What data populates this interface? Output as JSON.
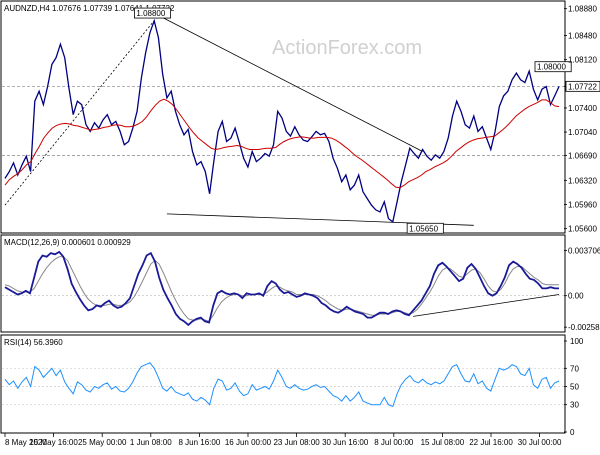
{
  "chart_data": [
    {
      "type": "line",
      "panel": "price",
      "title": "AUDNZD,H4  1.07676 1.07739 1.07641 1.07722",
      "watermark": "ActionForex.com",
      "ylim": [
        1.0555,
        1.0895
      ],
      "y_ticks": [
        "1.08880",
        "1.08480",
        "1.08120",
        "1.07722",
        "1.07400",
        "1.07040",
        "1.06690",
        "1.06320",
        "1.05960",
        "1.05600"
      ],
      "last_price": 1.07722,
      "last_price_label": "1.07722",
      "level_lines": [
        {
          "value": 1.0669,
          "label": "1.06690"
        },
        {
          "value": 1.07722,
          "label": "1.07722"
        }
      ],
      "annotations": [
        {
          "label": "1.08800",
          "x": 36,
          "y": 1.088
        },
        {
          "label": "1.05650",
          "x": 100,
          "y": 1.0565
        },
        {
          "label": "1.08000",
          "x": 130,
          "y": 1.08
        }
      ],
      "trendlines": [
        {
          "x": [
            36,
            98
          ],
          "y": [
            1.0878,
            1.0675
          ]
        },
        {
          "x": [
            38,
            110
          ],
          "y": [
            1.0582,
            1.0565
          ]
        },
        {
          "x": [
            0,
            36
          ],
          "y": [
            1.0595,
            1.0878
          ]
        }
      ],
      "series": [
        {
          "name": "price",
          "color": "#000080",
          "values": [
            1.0635,
            1.0645,
            1.0658,
            1.064,
            1.0655,
            1.0668,
            1.0645,
            1.075,
            1.0765,
            1.0745,
            1.0772,
            1.0805,
            1.0815,
            1.0835,
            1.0815,
            1.077,
            1.073,
            1.075,
            1.0745,
            1.0715,
            1.0705,
            1.0718,
            1.071,
            1.0722,
            1.073,
            1.0715,
            1.072,
            1.0705,
            1.0685,
            1.069,
            1.071,
            1.0735,
            1.0785,
            1.0822,
            1.0852,
            1.087,
            1.0845,
            1.079,
            1.0755,
            1.0765,
            1.0735,
            1.0715,
            1.07,
            1.0708,
            1.0675,
            1.0655,
            1.066,
            1.0645,
            1.0612,
            1.066,
            1.0705,
            1.072,
            1.069,
            1.0695,
            1.071,
            1.0688,
            1.0665,
            1.0652,
            1.0675,
            1.066,
            1.0665,
            1.0672,
            1.0668,
            1.0685,
            1.0735,
            1.0725,
            1.0705,
            1.0698,
            1.0712,
            1.07,
            1.0692,
            1.069,
            1.0697,
            1.0705,
            1.07,
            1.0702,
            1.069,
            1.0665,
            1.065,
            1.063,
            1.064,
            1.0618,
            1.0625,
            1.064,
            1.0615,
            1.0605,
            1.0595,
            1.0588,
            1.0585,
            1.06,
            1.0575,
            1.057,
            1.06,
            1.063,
            1.0655,
            1.068,
            1.0672,
            1.0665,
            1.0678,
            1.0668,
            1.0662,
            1.067,
            1.0665,
            1.0675,
            1.0695,
            1.0728,
            1.075,
            1.0735,
            1.0715,
            1.071,
            1.0728,
            1.0705,
            1.0712,
            1.0695,
            1.0678,
            1.0705,
            1.0742,
            1.0758,
            1.0765,
            1.0782,
            1.0792,
            1.0782,
            1.0778,
            1.0795,
            1.0768,
            1.0752,
            1.0768,
            1.0772,
            1.0745,
            1.0758,
            1.0772
          ]
        },
        {
          "name": "MA",
          "color": "#cc0000",
          "values": [
            1.0625,
            1.0633,
            1.0638,
            1.0642,
            1.0648,
            1.0655,
            1.066,
            1.0672,
            1.0683,
            1.0695,
            1.0703,
            1.071,
            1.0714,
            1.0716,
            1.0717,
            1.0716,
            1.0714,
            1.0713,
            1.0711,
            1.0709,
            1.0707,
            1.0708,
            1.0709,
            1.0711,
            1.0712,
            1.0714,
            1.0715,
            1.0714,
            1.0712,
            1.0712,
            1.0713,
            1.0716,
            1.072,
            1.0727,
            1.0736,
            1.0744,
            1.075,
            1.0753,
            1.075,
            1.0745,
            1.0737,
            1.0728,
            1.0719,
            1.071,
            1.0702,
            1.0695,
            1.069,
            1.0685,
            1.068,
            1.0678,
            1.0679,
            1.0681,
            1.0682,
            1.0683,
            1.0684,
            1.0683,
            1.068,
            1.0678,
            1.0678,
            1.0678,
            1.0679,
            1.068,
            1.068,
            1.0681,
            1.0686,
            1.069,
            1.0693,
            1.0695,
            1.0696,
            1.0697,
            1.0696,
            1.0695,
            1.0695,
            1.0696,
            1.0696,
            1.0696,
            1.0695,
            1.0692,
            1.0688,
            1.0683,
            1.0678,
            1.0672,
            1.0667,
            1.0663,
            1.0658,
            1.0653,
            1.0648,
            1.0643,
            1.0638,
            1.0633,
            1.0627,
            1.0622,
            1.0621,
            1.0625,
            1.063,
            1.0633,
            1.0636,
            1.064,
            1.0645,
            1.0648,
            1.0652,
            1.0655,
            1.0658,
            1.0662,
            1.0668,
            1.0675,
            1.068,
            1.0685,
            1.0689,
            1.0692,
            1.0694,
            1.0695,
            1.0696,
            1.0697,
            1.0698,
            1.0703,
            1.0708,
            1.0714,
            1.0721,
            1.0728,
            1.0733,
            1.0738,
            1.0742,
            1.0745,
            1.0748,
            1.0752,
            1.0752,
            1.0748,
            1.0743,
            1.0742
          ]
        }
      ]
    },
    {
      "type": "line",
      "panel": "macd",
      "title": "MACD(12,26,9) 0.000601 0.000929",
      "ylim": [
        -0.0029,
        0.004
      ],
      "y_ticks": [
        "0.003706",
        "0.00",
        "-0.002585"
      ],
      "trendlines": [
        {
          "x": [
            98,
            133
          ],
          "y": [
            -0.0017,
            0.0001
          ]
        }
      ],
      "series": [
        {
          "name": "MACD",
          "color": "#1a1a99",
          "values": [
            0.0007,
            0.0005,
            0.0003,
            0.0001,
            0.0002,
            0.0004,
            0.0002,
            0.0015,
            0.0028,
            0.0033,
            0.0032,
            0.0035,
            0.0034,
            0.0036,
            0.0032,
            0.0022,
            0.001,
            0.0003,
            -0.0003,
            -0.0008,
            -0.0012,
            -0.0011,
            -0.0008,
            -0.0009,
            -0.0006,
            -0.0004,
            -0.0008,
            -0.001,
            -0.0009,
            -0.0006,
            -0.0002,
            0.0008,
            0.0018,
            0.0025,
            0.0033,
            0.0035,
            0.0028,
            0.0015,
            0.0005,
            -0.0002,
            -0.0008,
            -0.0015,
            -0.0019,
            -0.0021,
            -0.0024,
            -0.0021,
            -0.0019,
            -0.0018,
            -0.0021,
            -0.0022,
            -0.0008,
            0.0002,
            0.0004,
            0.0002,
            0.0001,
            0.0002,
            0.0001,
            -0.0002,
            0.0002,
            0.0001,
            0.0001,
            0.0002,
            0.0,
            0.0008,
            0.0012,
            0.001,
            0.0005,
            0.0002,
            0.0003,
            0.0001,
            -0.0001,
            0.0,
            0.0002,
            0.0001,
            0.0,
            -0.0002,
            -0.0006,
            -0.0008,
            -0.0011,
            -0.0013,
            -0.0014,
            -0.0012,
            -0.0009,
            -0.0011,
            -0.0013,
            -0.0014,
            -0.0015,
            -0.0018,
            -0.0018,
            -0.0016,
            -0.0014,
            -0.0014,
            -0.0015,
            -0.0013,
            -0.0012,
            -0.0013,
            -0.0015,
            -0.0016,
            -0.0012,
            -0.0008,
            -0.0004,
            0.0002,
            0.0008,
            0.0018,
            0.0025,
            0.0027,
            0.0024,
            0.002,
            0.0016,
            0.0012,
            0.0014,
            0.0023,
            0.0026,
            0.0022,
            0.0015,
            0.0008,
            0.0002,
            0.0,
            0.0002,
            0.0008,
            0.0015,
            0.0025,
            0.0028,
            0.0026,
            0.0023,
            0.0018,
            0.0014,
            0.0013,
            0.001,
            0.0006,
            0.0006,
            0.0007,
            0.0006,
            0.0006
          ]
        },
        {
          "name": "Signal",
          "color": "#888888",
          "values": [
            0.0009,
            0.0008,
            0.0006,
            0.0004,
            0.0003,
            0.0003,
            0.0003,
            0.0006,
            0.0012,
            0.0018,
            0.0023,
            0.0027,
            0.003,
            0.0032,
            0.0032,
            0.0029,
            0.0022,
            0.0015,
            0.0008,
            0.0002,
            -0.0003,
            -0.0006,
            -0.0008,
            -0.0008,
            -0.0008,
            -0.0007,
            -0.0007,
            -0.0008,
            -0.0008,
            -0.0007,
            -0.0005,
            -0.0001,
            0.0005,
            0.0012,
            0.0019,
            0.0026,
            0.0029,
            0.0026,
            0.0019,
            0.0011,
            0.0003,
            -0.0004,
            -0.001,
            -0.0015,
            -0.0019,
            -0.002,
            -0.002,
            -0.0019,
            -0.002,
            -0.0021,
            -0.0016,
            -0.001,
            -0.0005,
            -0.0002,
            0.0,
            0.0001,
            0.0001,
            0.0,
            0.0,
            0.0001,
            0.0001,
            0.0001,
            0.0001,
            0.0003,
            0.0006,
            0.0008,
            0.0007,
            0.0005,
            0.0004,
            0.0003,
            0.0001,
            0.0001,
            0.0001,
            0.0001,
            0.0001,
            0.0,
            -0.0002,
            -0.0004,
            -0.0007,
            -0.0009,
            -0.0011,
            -0.0012,
            -0.0011,
            -0.0011,
            -0.0012,
            -0.0013,
            -0.0014,
            -0.0015,
            -0.0016,
            -0.0016,
            -0.0015,
            -0.0015,
            -0.0015,
            -0.0014,
            -0.0013,
            -0.0013,
            -0.0014,
            -0.0015,
            -0.0014,
            -0.0011,
            -0.0007,
            -0.0002,
            0.0003,
            0.0009,
            0.0016,
            0.0021,
            0.0023,
            0.0022,
            0.0019,
            0.0016,
            0.0015,
            0.0018,
            0.0021,
            0.0022,
            0.0019,
            0.0014,
            0.0008,
            0.0004,
            0.0003,
            0.0005,
            0.001,
            0.0017,
            0.0022,
            0.0024,
            0.0024,
            0.0021,
            0.0018,
            0.0015,
            0.0013,
            0.001,
            0.0009,
            0.0009,
            0.0009,
            0.0009
          ]
        }
      ]
    },
    {
      "type": "line",
      "panel": "rsi",
      "title": "RSI(14) 56.3960",
      "ylim": [
        0,
        100
      ],
      "y_ticks": [
        "100",
        "70",
        "50",
        "30",
        "0"
      ],
      "series": [
        {
          "name": "RSI",
          "color": "#1e90ff",
          "values": [
            58,
            52,
            56,
            48,
            55,
            60,
            50,
            72,
            68,
            60,
            65,
            70,
            62,
            68,
            55,
            48,
            42,
            55,
            52,
            46,
            44,
            50,
            48,
            52,
            54,
            47,
            50,
            45,
            44,
            48,
            55,
            65,
            72,
            74,
            76,
            70,
            60,
            48,
            45,
            50,
            44,
            42,
            40,
            43,
            36,
            34,
            38,
            35,
            30,
            48,
            58,
            56,
            46,
            48,
            54,
            45,
            40,
            42,
            52,
            46,
            48,
            50,
            47,
            56,
            68,
            60,
            50,
            48,
            52,
            48,
            46,
            47,
            50,
            52,
            49,
            50,
            45,
            40,
            38,
            34,
            40,
            34,
            38,
            44,
            34,
            32,
            30,
            30,
            30,
            38,
            30,
            28,
            42,
            52,
            58,
            62,
            56,
            54,
            58,
            54,
            52,
            55,
            53,
            56,
            64,
            72,
            74,
            64,
            56,
            55,
            64,
            53,
            56,
            48,
            45,
            58,
            70,
            68,
            70,
            74,
            72,
            64,
            62,
            70,
            52,
            48,
            58,
            60,
            48,
            54,
            56
          ]
        }
      ]
    }
  ],
  "x_tick_labels": [
    "8 May 2020",
    "15 May 16:00",
    "25 May 00:00",
    "1 Jun 08:00",
    "8 Jun 16:00",
    "16 Jun 00:00",
    "23 Jun 08:00",
    "30 Jun 16:00",
    "8 Jul 00:00",
    "15 Jul 08:00",
    "22 Jul 16:00",
    "30 Jul 00:00"
  ]
}
